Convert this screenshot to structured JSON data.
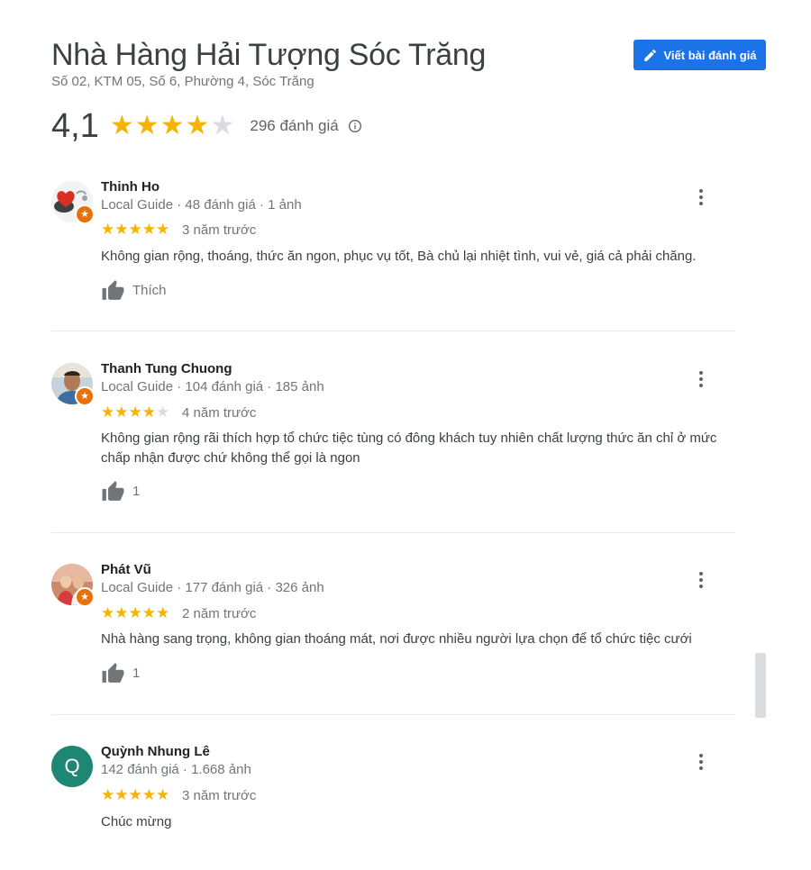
{
  "place": {
    "title": "Nhà Hàng Hải Tượng Sóc Trăng",
    "address": "Số 02, KTM 05, Số 6, Phường 4, Sóc Trăng",
    "write_review_label": "Viết bài đánh giá",
    "rating": "4,1",
    "rating_value": 4.1,
    "review_count": "296 đánh giá"
  },
  "colors": {
    "accent": "#1a73e8",
    "star": "#f4b400",
    "badge": "#e8710a"
  },
  "reviews": [
    {
      "name": "Thinh Ho",
      "meta": "Local Guide · 48 đánh giá · 1 ảnh",
      "stars": 5,
      "when": "3 năm trước",
      "text": "Không gian rộng, thoáng, thức ăn ngon, phục vụ tốt, Bà chủ lại nhiệt tình, vui vẻ, giá cả phải chăng.",
      "like_label": "Thích"
    },
    {
      "name": "Thanh Tung Chuong",
      "meta": "Local Guide · 104 đánh giá · 185 ảnh",
      "stars": 4,
      "when": "4 năm trước",
      "text": "Không gian rộng rãi thích hợp tổ chức tiệc tùng có đông khách tuy nhiên chất lượng thức ăn chỉ ở mức chấp nhận được chứ không thể gọi là ngon",
      "like_label": "1"
    },
    {
      "name": "Phát Vũ",
      "meta": "Local Guide · 177 đánh giá · 326 ảnh",
      "stars": 5,
      "when": "2 năm trước",
      "text": "Nhà hàng sang trọng, không gian thoáng mát, nơi được nhiều người lựa chọn để tổ chức tiệc cưới",
      "like_label": "1"
    },
    {
      "name": "Quỳnh Nhung Lê",
      "meta": "142 đánh giá · 1.668 ảnh",
      "stars": 5,
      "when": "3 năm trước",
      "text": "Chúc mừng",
      "avatar_letter": "Q"
    }
  ]
}
